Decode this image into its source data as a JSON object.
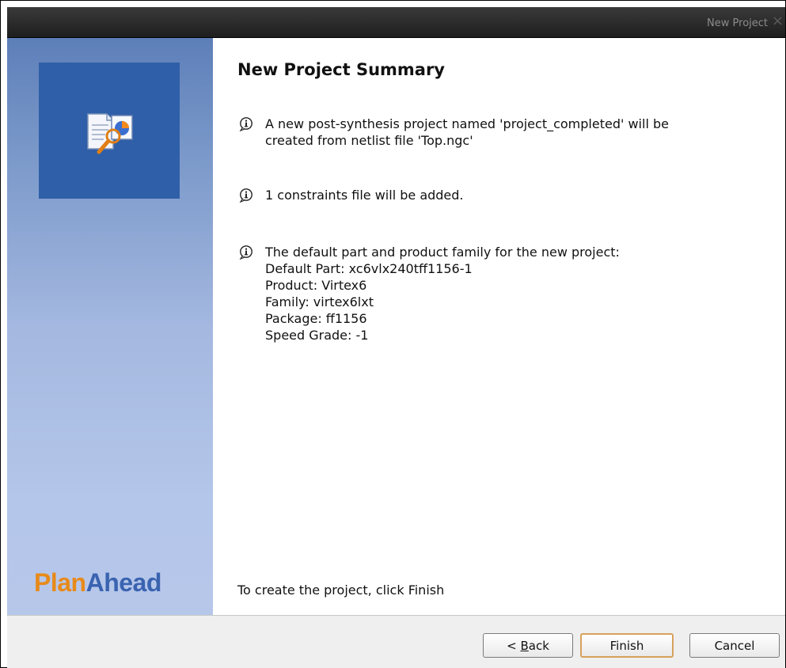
{
  "window": {
    "title": "New Project",
    "close_glyph": "×"
  },
  "sidebar": {
    "brand_part1": "Plan",
    "brand_part2": "Ahead",
    "icon": "project-summary-icon"
  },
  "main": {
    "heading": "New Project Summary",
    "info_items": [
      {
        "icon": "info-icon",
        "lines": [
          "A new post-synthesis project named 'project_completed' will be",
          "created from netlist file 'Top.ngc'"
        ]
      },
      {
        "icon": "info-icon",
        "lines": [
          "1 constraints file will be added."
        ]
      },
      {
        "icon": "info-icon",
        "lines": [
          "The default part and product family for the new project:",
          "Default Part: xc6vlx240tff1156-1",
          "Product: Virtex6",
          "Family: virtex6lxt",
          "Package: ff1156",
          "Speed Grade: -1"
        ]
      }
    ],
    "footer": "To create the project, click Finish"
  },
  "buttons": {
    "back_prefix": "< ",
    "back_mnemonic": "B",
    "back_rest": "ack",
    "finish": "Finish",
    "cancel": "Cancel"
  },
  "colors": {
    "brand_orange": "#e88a1a",
    "brand_blue": "#3a63b0",
    "default_button_border": "#d7a15b"
  }
}
